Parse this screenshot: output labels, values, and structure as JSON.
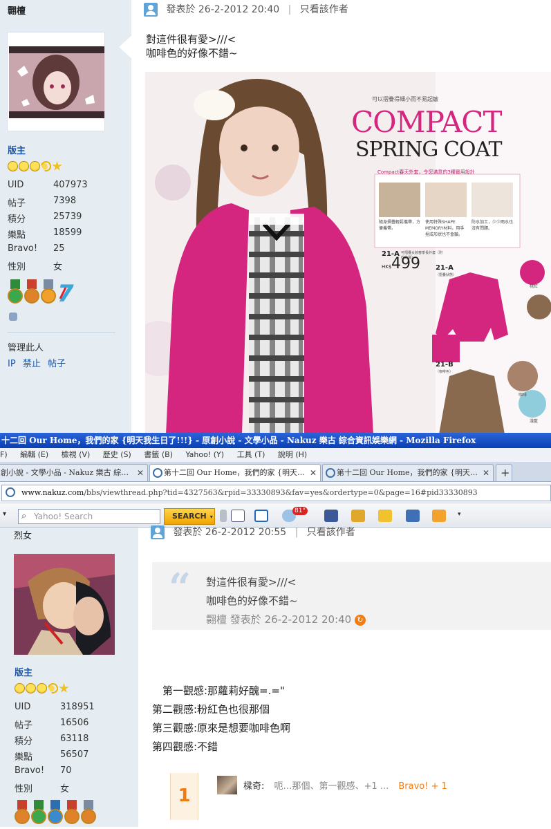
{
  "post1": {
    "username": "翾檀",
    "rank": "版主",
    "stats": [
      {
        "label": "UID",
        "value": "407973"
      },
      {
        "label": "帖子",
        "value": "7398"
      },
      {
        "label": "積分",
        "value": "25739"
      },
      {
        "label": "樂點",
        "value": "18599"
      },
      {
        "label": "Bravo!",
        "value": "25"
      },
      {
        "label": "性別",
        "value": "女"
      }
    ],
    "manage_title": "管理此人",
    "manage_links": [
      "IP",
      "禁止",
      "帖子"
    ],
    "posted_at": "發表於 26-2-2012 20:40",
    "author_only": "只看該作者",
    "body_lines": [
      "對這件很有愛>///<",
      "咖啡色的好像不錯~"
    ],
    "magazine": {
      "small_caption": "可以摺疊得細小而不易起皺",
      "headline1": "COMPACT",
      "headline2": "SPRING COAT",
      "subtitle": "Compact春天外套，令您滿意的3種實用設計",
      "feature1": "隨身摺疊輕鬆攜帶，方便攜帶。",
      "feature2": "使用特殊SHAPE MEMORY材料，用手捏成形狀也不會皺。",
      "feature3": "防水加工，少少雨水也沒有問題。",
      "item1_code": "21-A",
      "item1_desc": "可摺疊女裝春季長外套（附收納袋）",
      "price_prefix": "HK$",
      "price": "499",
      "item2_code": "21-A",
      "item2_desc": "（摺疊狀態）",
      "item3_code": "21-B",
      "item3_desc": "（咖啡色）",
      "swatch1": "桃紅",
      "swatch2": "咖啡",
      "swatch3": "淺藍"
    }
  },
  "browser": {
    "window_title": "十二回 Our Home，我們的家 {明天我生日了!!!} - 原創小說 - 文學小品 - Nakuz 樂古 綜合資訊娛樂網 - Mozilla Firefox",
    "menu": [
      "F)",
      "編輯 (E)",
      "檢視 (V)",
      "歷史 (S)",
      "書籤 (B)",
      "Yahoo! (Y)",
      "工具 (T)",
      "說明 (H)"
    ],
    "tabs": [
      {
        "label": "創小說 - 文學小品 - Nakuz 樂古 綜…"
      },
      {
        "label": "第十二回 Our Home，我們的家 {明天…"
      },
      {
        "label": "第十二回 Our Home，我們的家 {明天…"
      }
    ],
    "new_tab": "+",
    "url_domain": "www.nakuz.com",
    "url_path": "/bbs/viewthread.php?tid=4327563&rpid=33330893&fav=yes&ordertype=0&page=16#pid33330893",
    "search_placeholder": "Yahoo! Search",
    "search_button": "SEARCH",
    "weather": "81°"
  },
  "post2": {
    "username": "烈女",
    "rank": "版主",
    "stats": [
      {
        "label": "UID",
        "value": "318951"
      },
      {
        "label": "帖子",
        "value": "16506"
      },
      {
        "label": "積分",
        "value": "63118"
      },
      {
        "label": "樂點",
        "value": "56507"
      },
      {
        "label": "Bravo!",
        "value": "70"
      },
      {
        "label": "性別",
        "value": "女"
      }
    ],
    "posted_at": "發表於 26-2-2012 20:55",
    "author_only": "只看該作者",
    "quote_lines": [
      "對這件很有愛>///<",
      "咖啡色的好像不錯~"
    ],
    "quote_author": "翾檀",
    "quote_time": "發表於 26-2-2012 20:40",
    "body_lines": [
      "　第一觀感:那蘿莉好醜=.=\"",
      "第二觀感:粉紅色也很那個",
      "第三觀感:原來是想要咖啡色啊",
      "第四觀感:不錯"
    ],
    "rate_count": "1",
    "rater": "樑奇:",
    "rate_text": "呃…那個、第一觀感、+1 ...",
    "rate_bravo": "Bravo! + 1"
  }
}
